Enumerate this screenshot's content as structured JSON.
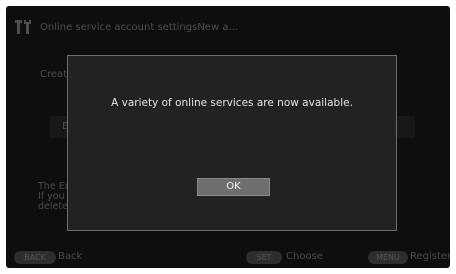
{
  "header": {
    "title": "Online service account settingsNew a..."
  },
  "background": {
    "create_label": "Create",
    "field_text": "E",
    "info_lines": [
      "The Er",
      "If you",
      "delete"
    ]
  },
  "footer": {
    "back_button": "BACK",
    "back_label": "Back",
    "set_button": "SET",
    "choose_label": "Choose",
    "menu_button": "MENU",
    "register_label": "Register"
  },
  "dialog": {
    "message": "A variety of online services are now available.",
    "ok_label": "OK"
  }
}
